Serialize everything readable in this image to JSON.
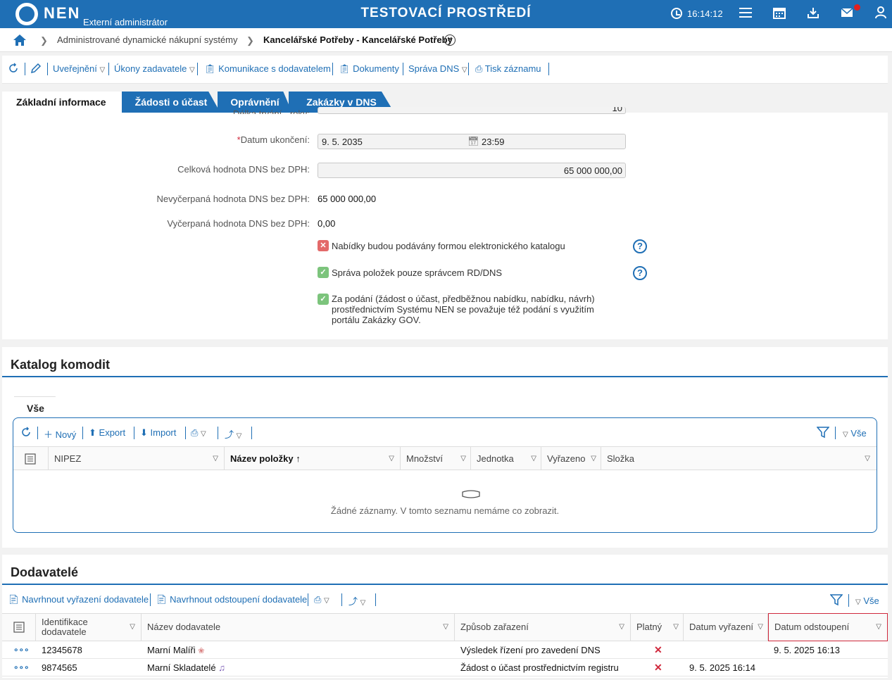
{
  "topbar": {
    "logo": "NEN",
    "subtitle": "Externí administrátor",
    "env_title": "TESTOVACÍ PROSTŘEDÍ",
    "clock": "16:14:12",
    "icons": [
      "menu-icon",
      "calendar-icon",
      "download-icon",
      "mail-icon",
      "user-icon"
    ],
    "accent": "#1f6fb5"
  },
  "breadcrumb": {
    "items": [
      "Administrované dynamické nákupní systémy",
      "Kancelářské Potřeby - Kancelářské Potřeby"
    ]
  },
  "toolbar": {
    "items": [
      "Uveřejnění",
      "Úkony zadavatele",
      "Komunikace s dodavatelem",
      "Dokumenty",
      "Správa DNS",
      "Tisk záznamu"
    ]
  },
  "tabs": [
    "Základní informace",
    "Žádosti o účast",
    "Oprávnění",
    "Zakázky v DNS"
  ],
  "form": {
    "cut_label": "Délka trvání - roky:",
    "cut_value": "10",
    "end_date_label": "Datum ukončení:",
    "end_date": "9. 5. 2035",
    "end_time": "23:59",
    "total_label": "Celková hodnota DNS bez DPH:",
    "total_value": "65 000 000,00",
    "unused_label": "Nevyčerpaná hodnota DNS bez DPH:",
    "unused_value": "65 000 000,00",
    "used_label": "Vyčerpaná hodnota DNS bez DPH:",
    "used_value": "0,00",
    "checks": [
      {
        "label": "Nabídky budou podávány formou elektronického katalogu",
        "checked": false
      },
      {
        "label": "Správa položek pouze správcem RD/DNS",
        "checked": true
      },
      {
        "label": "Za podání (žádost o účast, předběžnou nabídku, nabídku, návrh) prostřednictvím Systému NEN se považuje též podání s využitím portálu Zakázky GOV.",
        "checked": true
      }
    ]
  },
  "catalog": {
    "title": "Katalog komodit",
    "tab": "Vše",
    "toolbar": [
      "Nový",
      "Export",
      "Import"
    ],
    "filter_all": "Vše",
    "columns": [
      "NIPEZ",
      "Název položky",
      "Množství",
      "Jednotka",
      "Vyřazeno",
      "Složka"
    ],
    "empty_text": "Žádné záznamy. V tomto seznamu nemáme co zobrazit."
  },
  "suppliers": {
    "title": "Dodavatelé",
    "toolbar": [
      "Navrhnout vyřazení dodavatele",
      "Navrhnout odstoupení dodavatele"
    ],
    "filter_all": "Vše",
    "columns": [
      "Identifikace dodavatele",
      "Název dodavatele",
      "Způsob zařazení",
      "Platný",
      "Datum vyřazení",
      "Datum odstoupení"
    ],
    "rows": [
      {
        "id": "12345678",
        "name": "Marní Malíři",
        "mode": "Výsledek řízení pro zavedení DNS",
        "valid": false,
        "removed": "",
        "withdrawn": "9. 5. 2025 16:13"
      },
      {
        "id": "9874565",
        "name": "Marní Skladatelé",
        "mode": "Žádost o účast prostřednictvím registru",
        "valid": false,
        "removed": "9. 5. 2025 16:14",
        "withdrawn": ""
      }
    ]
  }
}
